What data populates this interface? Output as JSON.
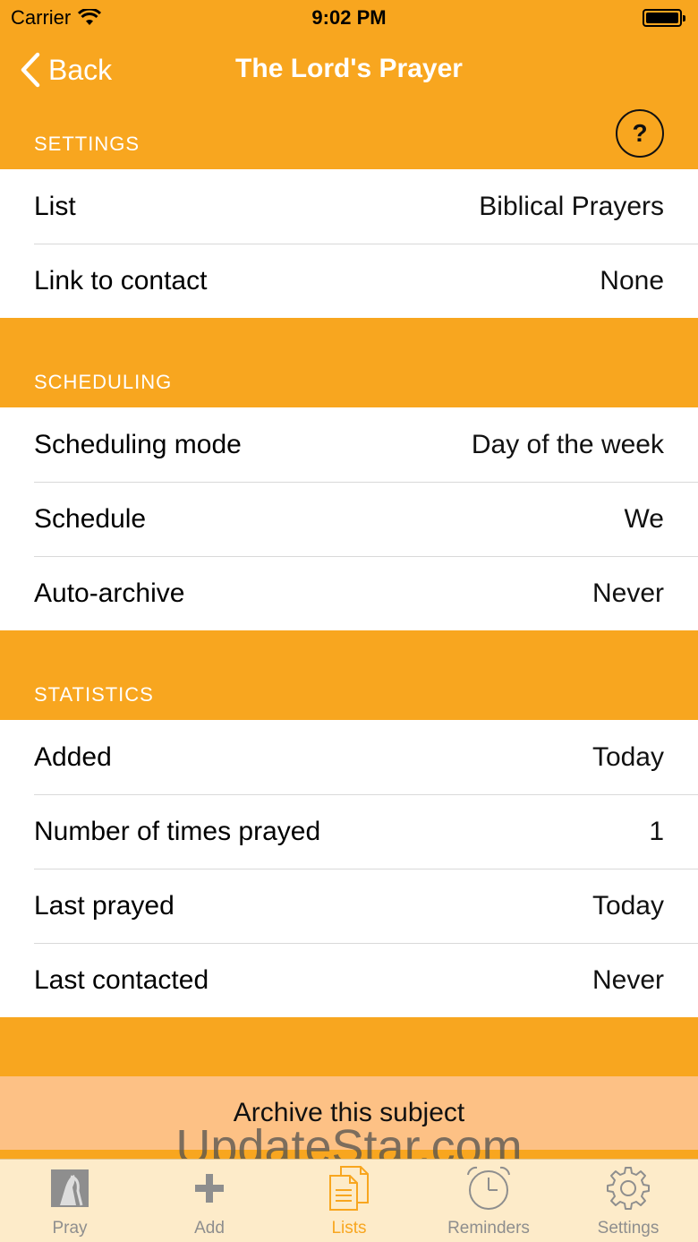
{
  "status_bar": {
    "carrier": "Carrier",
    "time": "9:02 PM"
  },
  "nav": {
    "back_label": "Back",
    "title": "The Lord's Prayer"
  },
  "sections": {
    "settings": {
      "header": "SETTINGS",
      "rows": [
        {
          "label": "List",
          "value": "Biblical Prayers"
        },
        {
          "label": "Link to contact",
          "value": "None"
        }
      ]
    },
    "scheduling": {
      "header": "SCHEDULING",
      "rows": [
        {
          "label": "Scheduling mode",
          "value": "Day of the week"
        },
        {
          "label": "Schedule",
          "value": "We"
        },
        {
          "label": "Auto-archive",
          "value": "Never"
        }
      ]
    },
    "statistics": {
      "header": "STATISTICS",
      "rows": [
        {
          "label": "Added",
          "value": "Today"
        },
        {
          "label": "Number of times prayed",
          "value": "1"
        },
        {
          "label": "Last prayed",
          "value": "Today"
        },
        {
          "label": "Last contacted",
          "value": "Never"
        }
      ]
    }
  },
  "help_label": "?",
  "archive_label": "Archive this subject",
  "watermark": "UpdateStar.com",
  "tabs": [
    {
      "label": "Pray",
      "icon": "praying-hands-icon"
    },
    {
      "label": "Add",
      "icon": "plus-icon"
    },
    {
      "label": "Lists",
      "icon": "document-list-icon",
      "active": true
    },
    {
      "label": "Reminders",
      "icon": "alarm-clock-icon"
    },
    {
      "label": "Settings",
      "icon": "gear-icon"
    }
  ],
  "colors": {
    "accent": "#f8a61f",
    "archive_bg": "#fdc185",
    "tab_bg": "#fdebc9",
    "inactive": "#8e8e8e"
  }
}
